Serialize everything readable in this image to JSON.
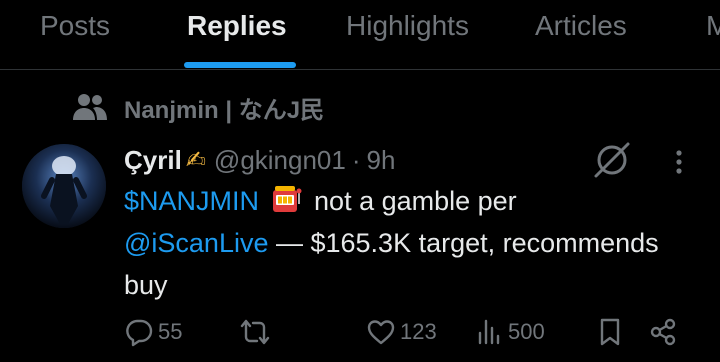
{
  "tabs": [
    {
      "label": "Posts"
    },
    {
      "label": "Replies"
    },
    {
      "label": "Highlights"
    },
    {
      "label": "Articles"
    },
    {
      "label": "M"
    }
  ],
  "active_tab": "Replies",
  "accent_color": "#1d9bf0",
  "social_context": {
    "icon": "people-icon",
    "text": "Nanjmin | なんJ民"
  },
  "tweet": {
    "display_name": "Çyril",
    "name_emoji": "✍",
    "handle": "@gkingn01",
    "separator": "·",
    "time": "9h",
    "body": {
      "cashtag": "$NANJMIN",
      "emoji": "slot-machine-icon",
      "text1": " not a gamble per",
      "mention": "@iScanLive",
      "text2": " — $165.3K target, recommends buy"
    },
    "actions": {
      "replies": "55",
      "reposts": "",
      "likes": "123",
      "views": "500"
    }
  }
}
